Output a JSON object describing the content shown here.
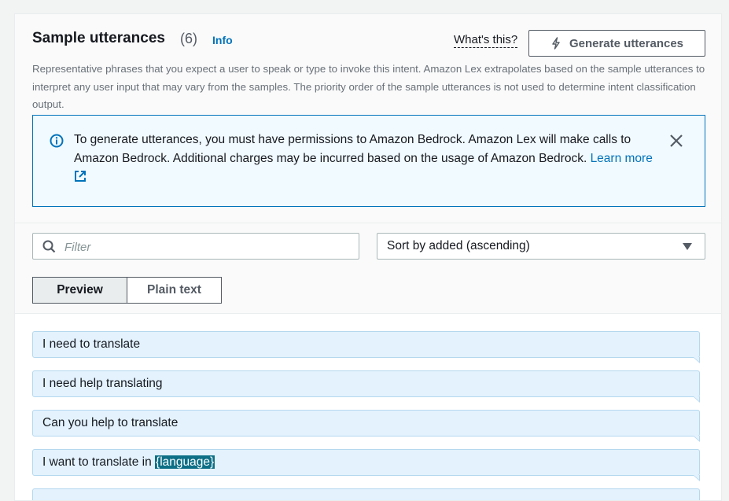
{
  "header": {
    "title": "Sample utterances",
    "count": "(6)",
    "info_link": "Info",
    "whats_this": "What's this?",
    "generate_button": "Generate utterances",
    "description": "Representative phrases that you expect a user to speak or type to invoke this intent. Amazon Lex extrapolates based on the sample utterances to interpret any user input that may vary from the samples. The priority order of the sample utterances is not used to determine intent classification output."
  },
  "alert": {
    "message": "To generate utterances, you must have permissions to Amazon Bedrock. Amazon Lex will make calls to Amazon Bedrock. Additional charges may be incurred based on the usage of Amazon Bedrock. ",
    "link_text": "Learn more",
    "icon": "info-circle-icon"
  },
  "filter": {
    "placeholder": "Filter",
    "value": ""
  },
  "sort": {
    "selected": "Sort by added (ascending)"
  },
  "view_toggle": {
    "preview": "Preview",
    "plain_text": "Plain text",
    "active": "preview"
  },
  "utterances": [
    {
      "text": "I need to translate"
    },
    {
      "text": "I need help translating"
    },
    {
      "text": "Can you help to translate"
    },
    {
      "prefix": "I want to translate in ",
      "slot": "{language}"
    }
  ],
  "colors": {
    "accent": "#0073bb",
    "utterance_bg": "#e3f2fd",
    "slot_bg": "#0d6f86",
    "alert_bg": "#f1faff"
  }
}
